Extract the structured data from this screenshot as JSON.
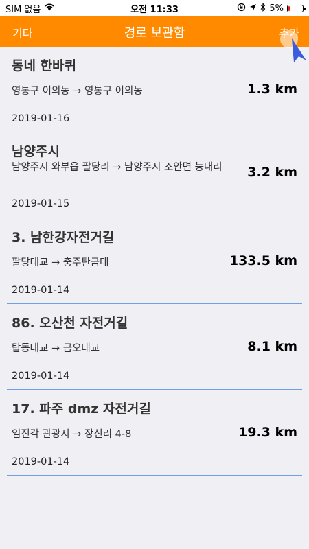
{
  "status_bar": {
    "carrier": "SIM 없음",
    "time": "오전 11:33",
    "battery": "5%",
    "battery_level": 0.05
  },
  "nav": {
    "left_label": "기타",
    "title": "경로 보관함",
    "right_label": "추가",
    "bar_color": "#ff8a00"
  },
  "routes": [
    {
      "name": "동네 한바퀴",
      "path": "영통구 이의동 → 영통구 이의동",
      "distance": "1.3 km",
      "date": "2019-01-16"
    },
    {
      "name": "남양주시",
      "path": "남양주시 와부읍 팔당리 → 남양주시 조안면 능내리",
      "distance": "3.2 km",
      "date": "2019-01-15"
    },
    {
      "name": "3. 남한강자전거길",
      "path": "팔당대교 → 충주탄금대",
      "distance": "133.5 km",
      "date": "2019-01-14"
    },
    {
      "name": "86. 오산천 자전거길",
      "path": "탑동대교 → 금오대교",
      "distance": "8.1 km",
      "date": "2019-01-14"
    },
    {
      "name": "17. 파주 dmz 자전거길",
      "path": "임진각 관광지 → 장신리 4-8",
      "distance": "19.3 km",
      "date": "2019-01-14"
    }
  ]
}
